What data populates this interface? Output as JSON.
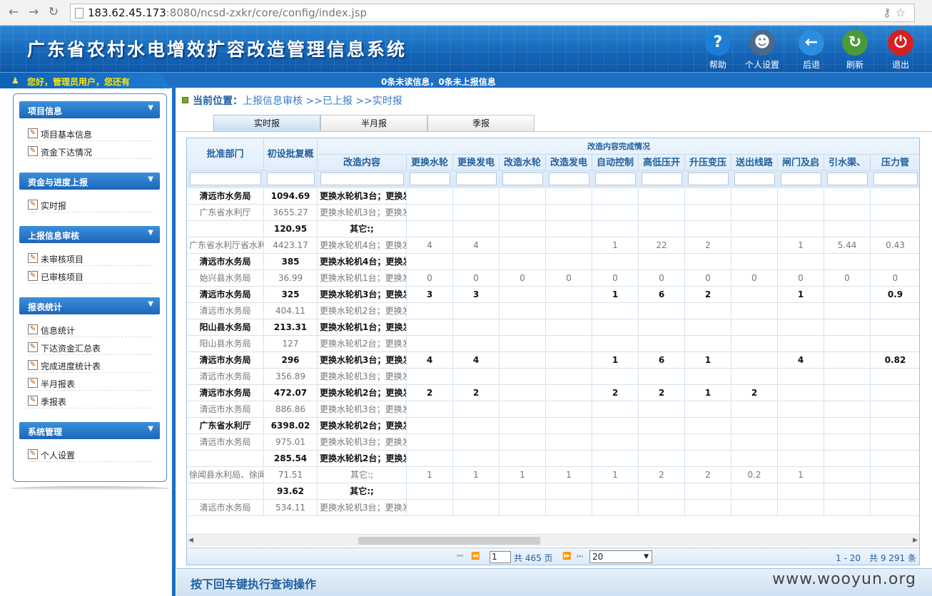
{
  "browser": {
    "url_host": "183.62.45.173",
    "url_rest": ":8080/ncsd-zxkr/core/config/index.jsp"
  },
  "header": {
    "title": "广东省农村水电增效扩容改造管理信息系统",
    "toolbar": [
      {
        "label": "帮助",
        "icon": "help-icon",
        "glyph": "?",
        "color": "#1b7fd8"
      },
      {
        "label": "个人设置",
        "icon": "user-settings-icon",
        "glyph": "☻",
        "color": "#4a6a8a"
      },
      {
        "label": "后退",
        "icon": "back-arrow-icon",
        "glyph": "←",
        "color": "#2c8ee0"
      },
      {
        "label": "刷新",
        "icon": "refresh-icon",
        "glyph": "↻",
        "color": "#4b9a3a"
      },
      {
        "label": "退出",
        "icon": "power-icon",
        "glyph": "⏻",
        "color": "#d62020"
      }
    ]
  },
  "status_bar": {
    "welcome": "您好，管理员用户，您还有",
    "message": "0条未读信息，0条未上报信息"
  },
  "sidebar": {
    "sections": [
      {
        "title": "项目信息",
        "items": [
          "项目基本信息",
          "资金下达情况"
        ]
      },
      {
        "title": "资金与进度上报",
        "items": [
          "实时报"
        ]
      },
      {
        "title": "上报信息审核",
        "items": [
          "未审核项目",
          "已审核项目"
        ]
      },
      {
        "title": "报表统计",
        "items": [
          "信息统计",
          "下达资金汇总表",
          "完成进度统计表",
          "半月报表",
          "季报表"
        ]
      },
      {
        "title": "系统管理",
        "items": [
          "个人设置"
        ]
      }
    ]
  },
  "breadcrumb": {
    "label": "当前位置：",
    "path": "上报信息审核 >>已上报 >>实时报"
  },
  "tabs": [
    "实时报",
    "半月报",
    "季报"
  ],
  "table": {
    "group_header": "改造内容完成情况",
    "columns": [
      "批准部门",
      "初设批复概",
      "改造内容",
      "更换水轮",
      "更换发电",
      "改造水轮",
      "改造发电",
      "自动控制",
      "高低压开",
      "升压变压",
      "送出线路",
      "闸门及启",
      "引水渠、",
      "压力管"
    ],
    "rows": [
      {
        "dept": "清远市水务局",
        "amount": "1094.69",
        "content": "更换水轮机3台；更换发",
        "bold": true,
        "vals": [
          "",
          "",
          "",
          "",
          "",
          "",
          "",
          "",
          "",
          "",
          ""
        ]
      },
      {
        "dept": "广东省水利厅",
        "amount": "3655.27",
        "content": "更换水轮机3台；更换发",
        "bold": false,
        "vals": [
          "",
          "",
          "",
          "",
          "",
          "",
          "",
          "",
          "",
          "",
          ""
        ]
      },
      {
        "dept": "",
        "amount": "120.95",
        "content": "其它:;",
        "bold": true,
        "vals": [
          "",
          "",
          "",
          "",
          "",
          "",
          "",
          "",
          "",
          "",
          ""
        ]
      },
      {
        "dept": "广东省水利厅省水利",
        "amount": "4423.17",
        "content": "更换水轮机4台；更换发",
        "bold": false,
        "vals": [
          "4",
          "4",
          "",
          "",
          "1",
          "22",
          "2",
          "",
          "1",
          "5.44",
          "0.43"
        ]
      },
      {
        "dept": "清远市水务局",
        "amount": "385",
        "content": "更换水轮机4台；更换发",
        "bold": true,
        "vals": [
          "",
          "",
          "",
          "",
          "",
          "",
          "",
          "",
          "",
          "",
          ""
        ]
      },
      {
        "dept": "始兴县水务局",
        "amount": "36.99",
        "content": "更换水轮机1台；更换发",
        "bold": false,
        "vals": [
          "0",
          "0",
          "0",
          "0",
          "0",
          "0",
          "0",
          "0",
          "0",
          "0",
          "0"
        ]
      },
      {
        "dept": "清远市水务局",
        "amount": "325",
        "content": "更换水轮机3台；更换发",
        "bold": true,
        "vals": [
          "3",
          "3",
          "",
          "",
          "1",
          "6",
          "2",
          "",
          "1",
          "",
          "0.9"
        ]
      },
      {
        "dept": "清远市水务局",
        "amount": "404.11",
        "content": "更换水轮机2台；更换发",
        "bold": false,
        "vals": [
          "",
          "",
          "",
          "",
          "",
          "",
          "",
          "",
          "",
          "",
          ""
        ]
      },
      {
        "dept": "阳山县水务局",
        "amount": "213.31",
        "content": "更换水轮机1台；更换发",
        "bold": true,
        "vals": [
          "",
          "",
          "",
          "",
          "",
          "",
          "",
          "",
          "",
          "",
          ""
        ]
      },
      {
        "dept": "阳山县水务局",
        "amount": "127",
        "content": "更换水轮机2台；更换发",
        "bold": false,
        "vals": [
          "",
          "",
          "",
          "",
          "",
          "",
          "",
          "",
          "",
          "",
          ""
        ]
      },
      {
        "dept": "清远市水务局",
        "amount": "296",
        "content": "更换水轮机3台；更换发",
        "bold": true,
        "vals": [
          "4",
          "4",
          "",
          "",
          "1",
          "6",
          "1",
          "",
          "4",
          "",
          "0.82"
        ]
      },
      {
        "dept": "清远市水务局",
        "amount": "356.89",
        "content": "更换水轮机3台；更换发",
        "bold": false,
        "vals": [
          "",
          "",
          "",
          "",
          "",
          "",
          "",
          "",
          "",
          "",
          ""
        ]
      },
      {
        "dept": "清远市水务局",
        "amount": "472.07",
        "content": "更换水轮机2台；更换发",
        "bold": true,
        "vals": [
          "2",
          "2",
          "",
          "",
          "2",
          "2",
          "1",
          "2",
          "",
          "",
          ""
        ]
      },
      {
        "dept": "清远市水务局",
        "amount": "886.86",
        "content": "更换水轮机3台；更换发",
        "bold": false,
        "vals": [
          "",
          "",
          "",
          "",
          "",
          "",
          "",
          "",
          "",
          "",
          ""
        ]
      },
      {
        "dept": "广东省水利厅",
        "amount": "6398.02",
        "content": "更换水轮机2台；更换发",
        "bold": true,
        "vals": [
          "",
          "",
          "",
          "",
          "",
          "",
          "",
          "",
          "",
          "",
          ""
        ]
      },
      {
        "dept": "清远市水务局",
        "amount": "975.01",
        "content": "更换水轮机3台；更换发",
        "bold": false,
        "vals": [
          "",
          "",
          "",
          "",
          "",
          "",
          "",
          "",
          "",
          "",
          ""
        ]
      },
      {
        "dept": "",
        "amount": "285.54",
        "content": "更换水轮机2台；更换发",
        "bold": true,
        "vals": [
          "",
          "",
          "",
          "",
          "",
          "",
          "",
          "",
          "",
          "",
          ""
        ]
      },
      {
        "dept": "徐闻县水利局、徐闻",
        "amount": "71.51",
        "content": "其它:;",
        "bold": false,
        "vals": [
          "1",
          "1",
          "1",
          "1",
          "1",
          "2",
          "2",
          "0.2",
          "1",
          "",
          ""
        ]
      },
      {
        "dept": "",
        "amount": "93.62",
        "content": "其它:;",
        "bold": true,
        "vals": [
          "",
          "",
          "",
          "",
          "",
          "",
          "",
          "",
          "",
          "",
          ""
        ]
      },
      {
        "dept": "清远市水务局",
        "amount": "534.11",
        "content": "更换水轮机3台；更换发",
        "bold": false,
        "vals": [
          "",
          "",
          "",
          "",
          "",
          "",
          "",
          "",
          "",
          "",
          ""
        ]
      }
    ]
  },
  "pager": {
    "page": "1",
    "total_pages": "共 465 页",
    "page_size": "20",
    "info": "1 - 20　共 9 291 条"
  },
  "footer": {
    "hint": "按下回车键执行查询操作",
    "watermark": "www.wooyun.org"
  }
}
